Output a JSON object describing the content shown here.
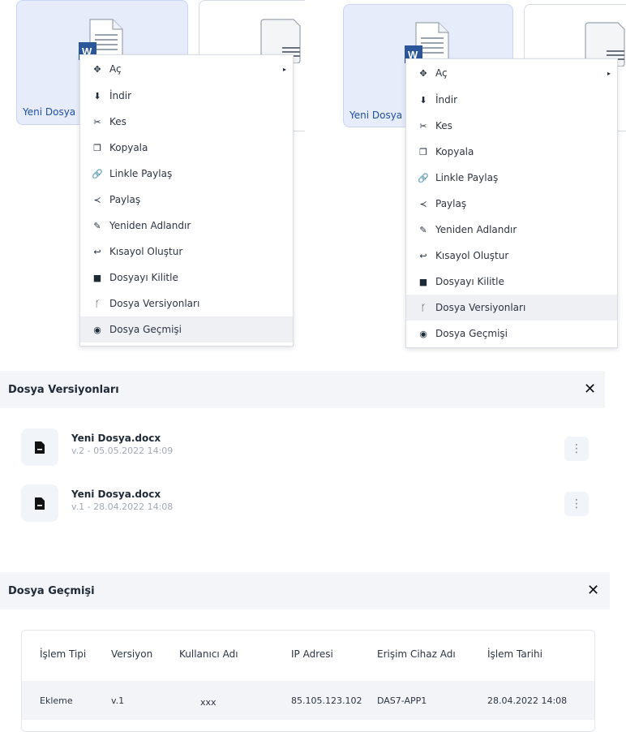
{
  "file_view": {
    "selected_file_name": "Yeni Dosya"
  },
  "context_menu": {
    "items": [
      {
        "label": "Aç",
        "icon": "move-arrows-icon"
      },
      {
        "label": "İndir",
        "icon": "download-icon"
      },
      {
        "label": "Kes",
        "icon": "scissors-icon"
      },
      {
        "label": "Kopyala",
        "icon": "copy-icon"
      },
      {
        "label": "Linkle Paylaş",
        "icon": "link-icon"
      },
      {
        "label": "Paylaş",
        "icon": "share-icon"
      },
      {
        "label": "Yeniden Adlandır",
        "icon": "edit-icon"
      },
      {
        "label": "Kısayol Oluştur",
        "icon": "reply-arrow-icon"
      },
      {
        "label": "Dosyayı Kilitle",
        "icon": "lock-icon"
      },
      {
        "label": "Dosya Versiyonları",
        "icon": "branch-icon"
      },
      {
        "label": "Dosya Geçmişi",
        "icon": "eye-icon"
      }
    ],
    "left_highlighted": "Dosya Geçmişi",
    "right_highlighted": "Dosya Versiyonları"
  },
  "versions_panel": {
    "title": "Dosya Versiyonları",
    "versions": [
      {
        "name": "Yeni Dosya.docx",
        "meta": "v.2 - 05.05.2022 14:09"
      },
      {
        "name": "Yeni Dosya.docx",
        "meta": "v.1 - 28.04.2022 14:08"
      }
    ]
  },
  "history_panel": {
    "title": "Dosya Geçmişi",
    "columns": [
      "İşlem Tipi",
      "Versiyon",
      "Kullanıcı Adı",
      "IP Adresi",
      "Erişim Cihaz Adı",
      "İşlem Tarihi"
    ],
    "rows": [
      [
        "Ekleme",
        "v.1",
        "xxx",
        "85.105.123.102",
        "DAS7-APP1",
        "28.04.2022 14:08"
      ]
    ]
  },
  "colors": {
    "accent_blue": "#1f4fa3",
    "word_blue": "#2b579a",
    "selected_tile_bg": "#e6ecfa",
    "menu_highlight": "#eef0f4"
  }
}
